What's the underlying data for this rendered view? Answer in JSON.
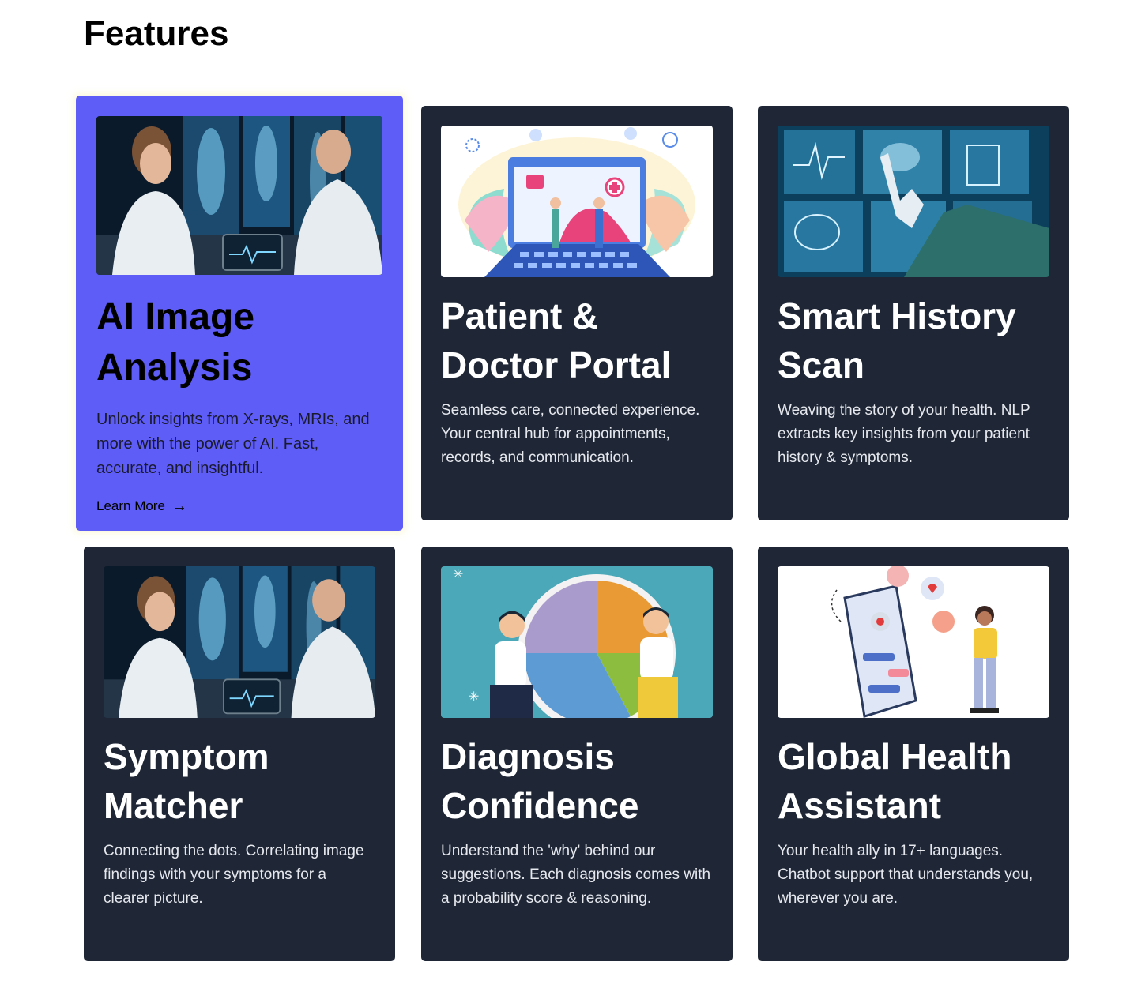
{
  "section": {
    "title": "Features"
  },
  "cards": [
    {
      "title": "AI Image Analysis",
      "description": "Unlock insights from X-rays, MRIs, and more with the power of AI. Fast, accurate, and insightful.",
      "link_label": "Learn More",
      "link_icon": "arrow-right-icon",
      "image": "doctors-reviewing-xray-image",
      "active": true,
      "accent": "#5f5df8"
    },
    {
      "title": "Patient & Doctor Portal",
      "description": "Seamless care, connected experience. Your central hub for appointments, records, and communication.",
      "image": "portal-illustration-image"
    },
    {
      "title": "Smart History Scan",
      "description": "Weaving the story of your health. NLP extracts key insights from your patient history & symptoms.",
      "image": "gloved-hand-medical-scans-image"
    },
    {
      "title": "Symptom Matcher",
      "description": "Connecting the dots. Correlating image findings with your symptoms for a clearer picture.",
      "image": "doctors-reviewing-xray-image"
    },
    {
      "title": "Diagnosis Confidence",
      "description": "Understand the 'why' behind our suggestions. Each diagnosis comes with a probability score & reasoning.",
      "image": "pie-chart-people-illustration-image"
    },
    {
      "title": "Global Health Assistant",
      "description": "Your health ally in 17+ languages. Chatbot support that understands you, wherever you are.",
      "image": "chatbot-phone-illustration-image"
    }
  ],
  "colors": {
    "card_background": "#1f2736",
    "active_card_background": "#5f5df8",
    "page_background": "#ffffff"
  }
}
